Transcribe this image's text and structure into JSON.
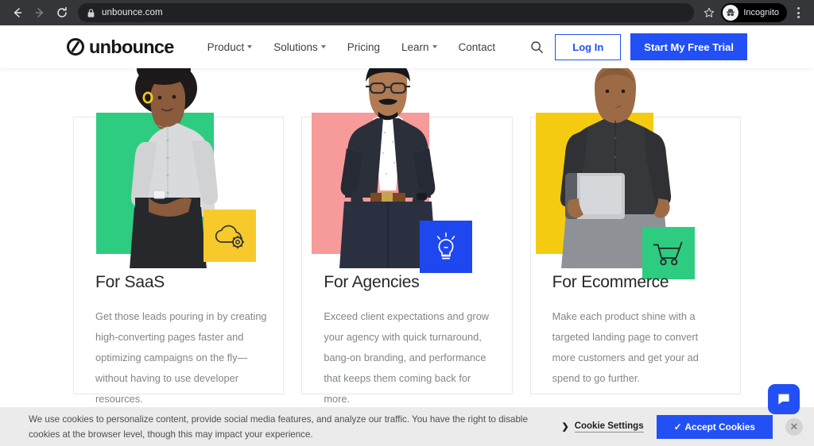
{
  "browser": {
    "back_label": "Back",
    "forward_label": "Forward",
    "reload_label": "Reload",
    "url": "unbounce.com",
    "lock_icon": "lock-icon",
    "star_icon": "star-icon",
    "profile_label": "Incognito",
    "menu_icon": "kebab-menu-icon"
  },
  "site": {
    "logo_text": "unbounce",
    "nav": [
      {
        "label": "Product",
        "has_caret": true
      },
      {
        "label": "Solutions",
        "has_caret": true
      },
      {
        "label": "Pricing",
        "has_caret": false
      },
      {
        "label": "Learn",
        "has_caret": true
      },
      {
        "label": "Contact",
        "has_caret": false
      }
    ],
    "search_icon": "search-icon",
    "login_label": "Log In",
    "trial_label": "Start My Free Trial",
    "accent_blue": "#2250f5"
  },
  "cards": [
    {
      "title": "For SaaS",
      "body": "Get those leads pouring in by creating high-converting pages faster and optimizing campaigns on the fly—without having to use developer resources.",
      "block_color": "#2ecc80",
      "badge_color": "#f7c92b",
      "badge_icon": "cloud-gear-icon",
      "shirt_color": "#d9dadc",
      "pants_color": "#26282b",
      "skin_color": "#8a5b3c",
      "hair_color": "#1d1a19"
    },
    {
      "title": "For Agencies",
      "body": "Exceed client expectations and grow your agency with quick turnaround, bang-on branding, and performance that keeps them coming back for more.",
      "block_color": "#f79a9a",
      "badge_color": "#1f47f0",
      "badge_icon": "lightbulb-icon",
      "shirt_color": "#ffffff",
      "pants_color": "#2a2f3a",
      "skin_color": "#b07a52",
      "hair_color": "#17181c"
    },
    {
      "title": "For Ecommerce",
      "body": "Make each product shine with a targeted landing page to convert more customers and get your ad spend to go further.",
      "block_color": "#f5cb11",
      "badge_color": "#2ecc80",
      "badge_icon": "shopping-cart-icon",
      "shirt_color": "#36383b",
      "pants_color": "#8e9195",
      "skin_color": "#9c6b46",
      "hair_color": "#9c6b46"
    }
  ],
  "cookie_banner": {
    "text": "We use cookies to personalize content, provide social media features, and analyze our traffic. You have the right to disable cookies at the browser level, though this may impact your experience.",
    "settings_label": "Cookie Settings",
    "settings_chevron": "chevron-right-icon",
    "accept_label": "Accept Cookies",
    "accept_check": "✓",
    "close_label": "✕"
  },
  "chat": {
    "icon": "chat-bubble-icon"
  }
}
